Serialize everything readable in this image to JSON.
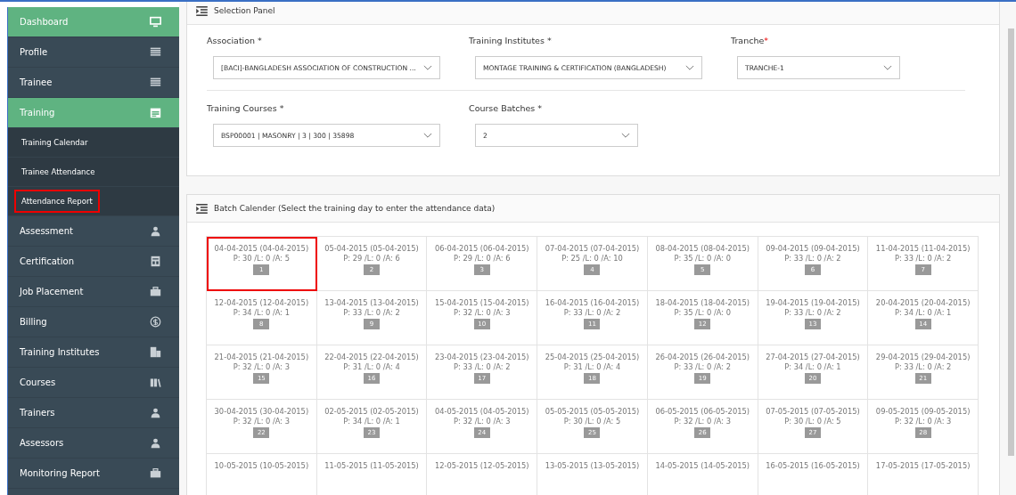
{
  "sidebar": {
    "items": [
      {
        "label": "Dashboard",
        "highlighted": true
      },
      {
        "label": "Profile",
        "highlighted": false
      },
      {
        "label": "Trainee",
        "highlighted": false
      },
      {
        "label": "Training",
        "highlighted": true,
        "children": [
          {
            "label": "Training Calendar",
            "selected": false
          },
          {
            "label": "Trainee Attendance",
            "selected": false
          },
          {
            "label": "Attendance Report",
            "selected": true
          }
        ]
      },
      {
        "label": "Assessment",
        "highlighted": false
      },
      {
        "label": "Certification",
        "highlighted": false
      },
      {
        "label": "Job Placement",
        "highlighted": false
      },
      {
        "label": "Billing",
        "highlighted": false
      },
      {
        "label": "Training Institutes",
        "highlighted": false
      },
      {
        "label": "Courses",
        "highlighted": false
      },
      {
        "label": "Trainers",
        "highlighted": false
      },
      {
        "label": "Assessors",
        "highlighted": false
      },
      {
        "label": "Monitoring Report",
        "highlighted": false
      }
    ]
  },
  "selection_panel": {
    "title": "Selection Panel",
    "rows": [
      [
        {
          "label": "Association *",
          "value": "[BACI]-BANGLADESH ASSOCIATION OF CONSTRUCTION ..."
        },
        {
          "label": "Training Institutes *",
          "value": "MONTAGE TRAINING & CERTIFICATION (BANGLADESH)"
        },
        {
          "label": "Tranche",
          "required_mark": "*",
          "value": "TRANCHE-1"
        }
      ],
      [
        {
          "label": "Training Courses *",
          "value": "BSP00001 | MASONRY | 3 | 300 | 35898"
        },
        {
          "label": "Course Batches *",
          "value": "2"
        }
      ]
    ]
  },
  "batch_calendar": {
    "title": "Batch Calender (Select the training day to enter the attendance data)",
    "days": [
      {
        "date": "04-04-2015 (04-04-2015)",
        "counts": "P: 30 /L: 0 /A: 5",
        "number": "1",
        "selected": true
      },
      {
        "date": "05-04-2015 (05-04-2015)",
        "counts": "P: 29 /L: 0 /A: 6",
        "number": "2",
        "selected": false
      },
      {
        "date": "06-04-2015 (06-04-2015)",
        "counts": "P: 29 /L: 0 /A: 6",
        "number": "3",
        "selected": false
      },
      {
        "date": "07-04-2015 (07-04-2015)",
        "counts": "P: 25 /L: 0 /A: 10",
        "number": "4",
        "selected": false
      },
      {
        "date": "08-04-2015 (08-04-2015)",
        "counts": "P: 35 /L: 0 /A: 0",
        "number": "5",
        "selected": false
      },
      {
        "date": "09-04-2015 (09-04-2015)",
        "counts": "P: 33 /L: 0 /A: 2",
        "number": "6",
        "selected": false
      },
      {
        "date": "11-04-2015 (11-04-2015)",
        "counts": "P: 33 /L: 0 /A: 2",
        "number": "7",
        "selected": false
      },
      {
        "date": "12-04-2015 (12-04-2015)",
        "counts": "P: 34 /L: 0 /A: 1",
        "number": "8",
        "selected": false
      },
      {
        "date": "13-04-2015 (13-04-2015)",
        "counts": "P: 33 /L: 0 /A: 2",
        "number": "9",
        "selected": false
      },
      {
        "date": "15-04-2015 (15-04-2015)",
        "counts": "P: 32 /L: 0 /A: 3",
        "number": "10",
        "selected": false
      },
      {
        "date": "16-04-2015 (16-04-2015)",
        "counts": "P: 33 /L: 0 /A: 2",
        "number": "11",
        "selected": false
      },
      {
        "date": "18-04-2015 (18-04-2015)",
        "counts": "P: 35 /L: 0 /A: 0",
        "number": "12",
        "selected": false
      },
      {
        "date": "19-04-2015 (19-04-2015)",
        "counts": "P: 33 /L: 0 /A: 2",
        "number": "13",
        "selected": false
      },
      {
        "date": "20-04-2015 (20-04-2015)",
        "counts": "P: 34 /L: 0 /A: 1",
        "number": "14",
        "selected": false
      },
      {
        "date": "21-04-2015 (21-04-2015)",
        "counts": "P: 32 /L: 0 /A: 3",
        "number": "15",
        "selected": false
      },
      {
        "date": "22-04-2015 (22-04-2015)",
        "counts": "P: 31 /L: 0 /A: 4",
        "number": "16",
        "selected": false
      },
      {
        "date": "23-04-2015 (23-04-2015)",
        "counts": "P: 33 /L: 0 /A: 2",
        "number": "17",
        "selected": false
      },
      {
        "date": "25-04-2015 (25-04-2015)",
        "counts": "P: 31 /L: 0 /A: 4",
        "number": "18",
        "selected": false
      },
      {
        "date": "26-04-2015 (26-04-2015)",
        "counts": "P: 33 /L: 0 /A: 2",
        "number": "19",
        "selected": false
      },
      {
        "date": "27-04-2015 (27-04-2015)",
        "counts": "P: 34 /L: 0 /A: 1",
        "number": "20",
        "selected": false
      },
      {
        "date": "29-04-2015 (29-04-2015)",
        "counts": "P: 33 /L: 0 /A: 2",
        "number": "21",
        "selected": false
      },
      {
        "date": "30-04-2015 (30-04-2015)",
        "counts": "P: 32 /L: 0 /A: 3",
        "number": "22",
        "selected": false
      },
      {
        "date": "02-05-2015 (02-05-2015)",
        "counts": "P: 34 /L: 0 /A: 1",
        "number": "23",
        "selected": false
      },
      {
        "date": "04-05-2015 (04-05-2015)",
        "counts": "P: 32 /L: 0 /A: 3",
        "number": "24",
        "selected": false
      },
      {
        "date": "05-05-2015 (05-05-2015)",
        "counts": "P: 30 /L: 0 /A: 5",
        "number": "25",
        "selected": false
      },
      {
        "date": "06-05-2015 (06-05-2015)",
        "counts": "P: 32 /L: 0 /A: 3",
        "number": "26",
        "selected": false
      },
      {
        "date": "07-05-2015 (07-05-2015)",
        "counts": "P: 30 /L: 0 /A: 5",
        "number": "27",
        "selected": false
      },
      {
        "date": "09-05-2015 (09-05-2015)",
        "counts": "P: 32 /L: 0 /A: 3",
        "number": "28",
        "selected": false
      },
      {
        "date": "10-05-2015 (10-05-2015)",
        "selected": false
      },
      {
        "date": "11-05-2015 (11-05-2015)",
        "selected": false
      },
      {
        "date": "12-05-2015 (12-05-2015)",
        "selected": false
      },
      {
        "date": "13-05-2015 (13-05-2015)",
        "selected": false
      },
      {
        "date": "14-05-2015 (14-05-2015)",
        "selected": false
      },
      {
        "date": "16-05-2015 (16-05-2015)",
        "selected": false
      },
      {
        "date": "17-05-2015 (17-05-2015)",
        "selected": false
      }
    ]
  }
}
